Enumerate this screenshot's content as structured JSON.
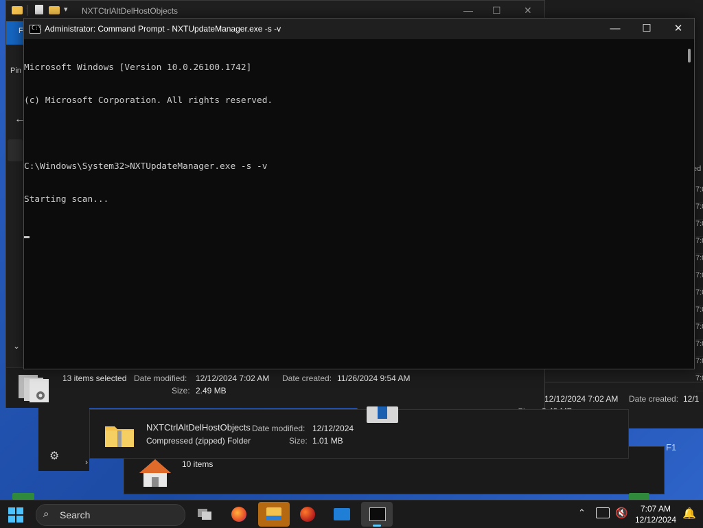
{
  "explorer": {
    "title": "NXTCtrlAltDelHostObjects",
    "left_partial_1": "F",
    "left_partial_2": "Pin",
    "details": {
      "selected": "13 items selected",
      "date_modified_label": "Date modified:",
      "date_modified_value": "12/12/2024 7:02 AM",
      "date_created_label": "Date created:",
      "date_created_value": "11/26/2024 9:54 AM",
      "size_label": "Size:",
      "size_value": "2.49 MB"
    },
    "right_details": {
      "date_modified_value": "12/12/2024 7:02 AM",
      "date_created_label": "Date created:",
      "date_created_value": "12/1",
      "size_label": "Size:",
      "size_value": "2.49 MB",
      "col_header_partial": "ed",
      "row_partials": [
        "7:0",
        "7:0",
        "7:0",
        "7:0",
        "7:0",
        "7:0",
        "7:0",
        "7:0",
        "7:0",
        "7:0",
        "7:0",
        "7:0"
      ],
      "f1_text": "F1"
    },
    "zip": {
      "name": "NXTCtrlAltDelHostObjects",
      "type": "Compressed (zipped) Folder",
      "date_modified_label": "Date modified:",
      "date_modified_value": "12/12/2024",
      "size_label": "Size:",
      "size_value": "1.01 MB"
    },
    "home": {
      "count": "10 items"
    }
  },
  "cmd": {
    "title": "Administrator: Command Prompt - NXTUpdateManager.exe  -s -v",
    "lines": [
      "Microsoft Windows [Version 10.0.26100.1742]",
      "(c) Microsoft Corporation. All rights reserved.",
      "",
      "C:\\Windows\\System32>NXTUpdateManager.exe -s -v",
      "Starting scan..."
    ],
    "icon_glyph": "C:\\"
  },
  "taskbar": {
    "search_label": "Search",
    "time": "7:07 AM",
    "date": "12/12/2024",
    "apps": [
      "task-view",
      "firefox",
      "file-explorer",
      "app-red",
      "network-monitor",
      "command-prompt"
    ]
  },
  "colors": {
    "accent": "#60cdff",
    "desktop": "#1e4aa8",
    "cmd_bg": "#0c0c0c",
    "explorer_highlight": "#b56a12"
  }
}
